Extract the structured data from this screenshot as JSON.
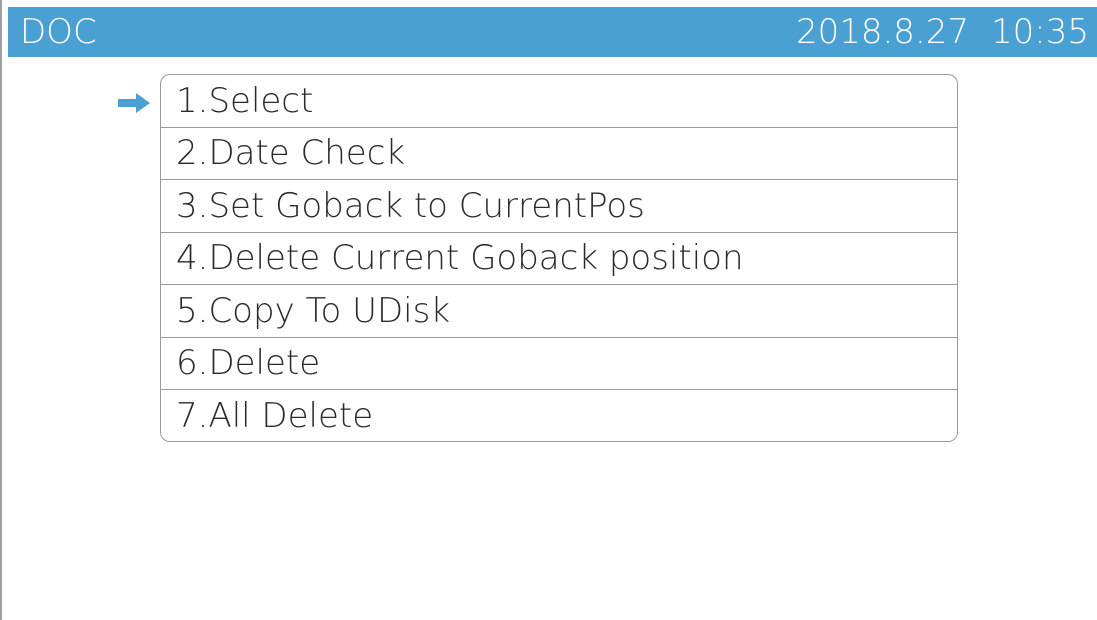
{
  "header": {
    "title": "DOC",
    "date": "2018.8.27",
    "time": "10:35"
  },
  "menu": {
    "selected_index": 0,
    "items": [
      {
        "label": "1.Select"
      },
      {
        "label": "2.Date Check"
      },
      {
        "label": "3.Set Goback to CurrentPos"
      },
      {
        "label": "4.Delete Current Goback position"
      },
      {
        "label": "5.Copy To UDisk"
      },
      {
        "label": "6.Delete"
      },
      {
        "label": "7.All Delete"
      }
    ]
  },
  "colors": {
    "header_bg": "#4a9fd3",
    "pointer": "#4a9fd3"
  },
  "icons": {
    "pointer": "right-arrow-icon"
  }
}
